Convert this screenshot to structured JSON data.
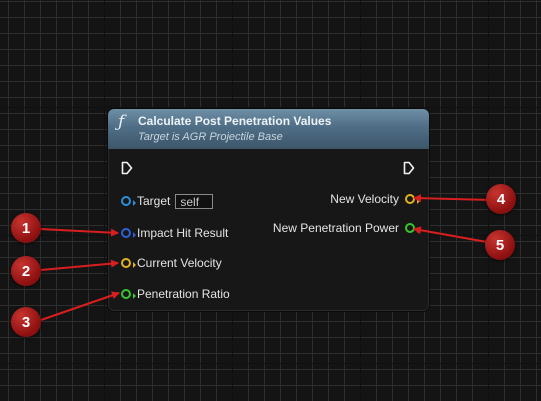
{
  "node": {
    "icon": "function-icon",
    "title": "Calculate Post Penetration Values",
    "subtitle": "Target is AGR Projectile Base",
    "inputs": [
      {
        "label": "Target",
        "default": "self",
        "pin_color": "#2d8fd8"
      },
      {
        "label": "Impact Hit Result",
        "pin_color": "#2d5fd8"
      },
      {
        "label": "Current Velocity",
        "pin_color": "#e0b21f"
      },
      {
        "label": "Penetration Ratio",
        "pin_color": "#39c52e"
      }
    ],
    "outputs": [
      {
        "label": "New Velocity",
        "pin_color": "#e0b21f"
      },
      {
        "label": "New Penetration Power",
        "pin_color": "#39c52e"
      }
    ]
  },
  "annotations": {
    "badges": [
      "1",
      "2",
      "3",
      "4",
      "5"
    ],
    "badge_color": "#b31b1b",
    "arrow_color": "#d81e1e"
  }
}
